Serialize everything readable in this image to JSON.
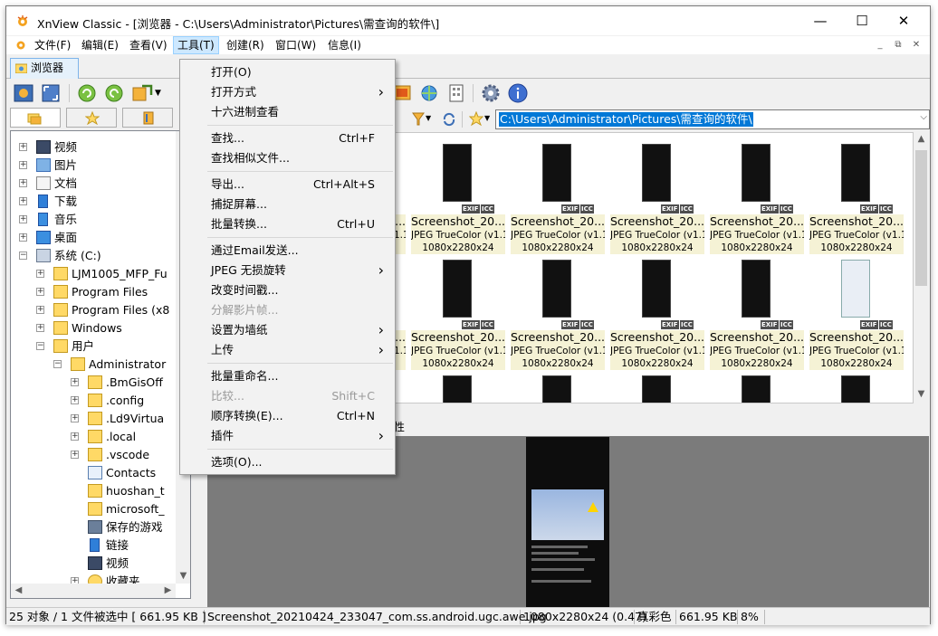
{
  "window": {
    "title": "XnView Classic - [浏览器 - C:\\Users\\Administrator\\Pictures\\需查询的软件\\]",
    "minimize": "—",
    "maximize": "☐",
    "close": "✕"
  },
  "menubar": {
    "items": [
      "文件(F)",
      "编辑(E)",
      "查看(V)",
      "工具(T)",
      "创建(R)",
      "窗口(W)",
      "信息(I)"
    ],
    "mdi": [
      "_",
      "⧉",
      "✕"
    ]
  },
  "tabs": {
    "browser": "浏览器"
  },
  "address": {
    "path": "C:\\Users\\Administrator\\Pictures\\需查询的软件\\"
  },
  "tree": {
    "items": [
      {
        "label": "视频",
        "icon": "video-folder-icon"
      },
      {
        "label": "图片",
        "icon": "pictures-folder-icon"
      },
      {
        "label": "文档",
        "icon": "documents-folder-icon"
      },
      {
        "label": "下载",
        "icon": "download-icon"
      },
      {
        "label": "音乐",
        "icon": "music-icon"
      },
      {
        "label": "桌面",
        "icon": "desktop-icon"
      },
      {
        "label": "系统 (C:)",
        "icon": "drive-icon"
      },
      {
        "label": "LJM1005_MFP_Fu",
        "icon": "folder-icon"
      },
      {
        "label": "Program Files",
        "icon": "folder-icon"
      },
      {
        "label": "Program Files (x8",
        "icon": "folder-icon"
      },
      {
        "label": "Windows",
        "icon": "folder-icon"
      },
      {
        "label": "用户",
        "icon": "folder-icon"
      },
      {
        "label": "Administrator",
        "icon": "folder-icon"
      },
      {
        "label": ".BmGisOff",
        "icon": "folder-icon"
      },
      {
        "label": ".config",
        "icon": "folder-icon"
      },
      {
        "label": ".Ld9Virtua",
        "icon": "folder-icon"
      },
      {
        "label": ".local",
        "icon": "folder-icon"
      },
      {
        "label": ".vscode",
        "icon": "folder-icon"
      },
      {
        "label": "Contacts",
        "icon": "contacts-icon"
      },
      {
        "label": "huoshan_t",
        "icon": "folder-icon"
      },
      {
        "label": "microsoft_",
        "icon": "folder-icon"
      },
      {
        "label": "保存的游戏",
        "icon": "games-icon"
      },
      {
        "label": "链接",
        "icon": "link-icon"
      },
      {
        "label": "视频",
        "icon": "video-folder-icon"
      },
      {
        "label": "收藏夹",
        "icon": "star-icon"
      }
    ]
  },
  "thumbs": {
    "caption_name": "Screenshot_20...",
    "caption_type": "JPEG TrueColor (v1.1)",
    "caption_dims": "1080x2280x24",
    "badge_exif": "EXIF",
    "badge_icc": "ICC"
  },
  "preview": {
    "tab_label": "属性"
  },
  "dropdown": {
    "items": [
      {
        "label": "打开(O)",
        "shortcut": "",
        "submenu": false,
        "disabled": false
      },
      {
        "label": "打开方式",
        "shortcut": "",
        "submenu": true,
        "disabled": false
      },
      {
        "label": "十六进制查看",
        "shortcut": "",
        "submenu": false,
        "disabled": false
      },
      {
        "label": "查找...",
        "shortcut": "Ctrl+F",
        "submenu": false,
        "disabled": false
      },
      {
        "label": "查找相似文件...",
        "shortcut": "",
        "submenu": false,
        "disabled": false
      },
      {
        "label": "导出...",
        "shortcut": "Ctrl+Alt+S",
        "submenu": false,
        "disabled": false
      },
      {
        "label": "捕捉屏幕...",
        "shortcut": "",
        "submenu": false,
        "disabled": false
      },
      {
        "label": "批量转换...",
        "shortcut": "Ctrl+U",
        "submenu": false,
        "disabled": false
      },
      {
        "label": "通过Email发送...",
        "shortcut": "",
        "submenu": false,
        "disabled": false
      },
      {
        "label": "JPEG 无损旋转",
        "shortcut": "",
        "submenu": true,
        "disabled": false
      },
      {
        "label": "改变时间戳...",
        "shortcut": "",
        "submenu": false,
        "disabled": false
      },
      {
        "label": "分解影片帧...",
        "shortcut": "",
        "submenu": false,
        "disabled": true
      },
      {
        "label": "设置为墙纸",
        "shortcut": "",
        "submenu": true,
        "disabled": false
      },
      {
        "label": "上传",
        "shortcut": "",
        "submenu": true,
        "disabled": false
      },
      {
        "label": "批量重命名...",
        "shortcut": "",
        "submenu": false,
        "disabled": false
      },
      {
        "label": "比较...",
        "shortcut": "Shift+C",
        "submenu": false,
        "disabled": true
      },
      {
        "label": "顺序转换(E)...",
        "shortcut": "Ctrl+N",
        "submenu": false,
        "disabled": false
      },
      {
        "label": "插件",
        "shortcut": "",
        "submenu": true,
        "disabled": false
      },
      {
        "label": "选项(O)...",
        "shortcut": "",
        "submenu": false,
        "disabled": false
      }
    ]
  },
  "status": {
    "count": "25 对象 / 1 文件被选中  [ 661.95 KB ]",
    "filename": "Screenshot_20210424_233047_com.ss.android.ugc.awe.jpg",
    "dims": "1080x2280x24 (0.47)",
    "color": "真彩色",
    "size": "661.95 KB",
    "zoom": "8%"
  }
}
